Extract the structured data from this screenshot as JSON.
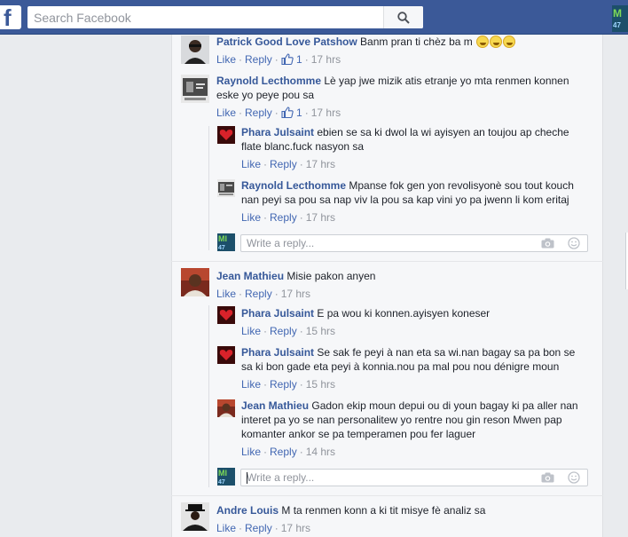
{
  "search": {
    "placeholder": "Search Facebook"
  },
  "colors": {
    "topbar": "#3b5998",
    "link": "#365899",
    "action_link": "#4267b2",
    "meta": "#90949c"
  },
  "comments": [
    {
      "name": "Patrick Good Love Patshow",
      "text": "Banm pran ti chèz ba m",
      "emoji_count": 3,
      "like": "Like",
      "reply": "Reply",
      "likes": "1",
      "time": "17 hrs"
    },
    {
      "name": "Raynold Lecthomme",
      "text_lines": [
        "Lè yap jwe mizik atis etranje yo mta renmen konnen",
        "eske yo peye pou sa"
      ],
      "like": "Like",
      "reply": "Reply",
      "likes": "1",
      "time": "17 hrs",
      "replies": [
        {
          "name": "Phara Julsaint",
          "text_lines": [
            "ebien se sa ki dwol la wi ayisyen an toujou ap cheche",
            "flate blanc.fuck nasyon sa"
          ],
          "like": "Like",
          "reply": "Reply",
          "time": "17 hrs"
        },
        {
          "name": "Raynold Lecthomme",
          "text_lines": [
            "Mpanse fok gen yon revolisyonè sou tout kouch",
            "nan peyi sa pou sa nap viv la pou sa kap vini yo pa jwenn li kom eritaj"
          ],
          "like": "Like",
          "reply": "Reply",
          "time": "17 hrs"
        }
      ],
      "reply_box": {
        "placeholder": "Write a reply..."
      }
    },
    {
      "name": "Jean Mathieu",
      "text": "Misie pakon anyen",
      "like": "Like",
      "reply": "Reply",
      "time": "17 hrs",
      "replies": [
        {
          "name": "Phara Julsaint",
          "text_lines": [
            "E pa wou ki konnen.ayisyen koneser"
          ],
          "like": "Like",
          "reply": "Reply",
          "time": "15 hrs"
        },
        {
          "name": "Phara Julsaint",
          "text_lines": [
            "Se sak fe peyi à nan eta sa wi.nan bagay sa pa bon se",
            "sa ki bon gade eta peyi à konnia.nou pa mal pou nou dénigre moun"
          ],
          "like": "Like",
          "reply": "Reply",
          "time": "15 hrs"
        },
        {
          "name": "Jean Mathieu",
          "text_lines": [
            "Gadon ekip moun depui ou di youn bagay ki pa aller nan",
            "interet pa yo se nan personalitew yo rentre nou gin reson Mwen pap",
            "komanter ankor se pa temperamen pou fer laguer"
          ],
          "like": "Like",
          "reply": "Reply",
          "time": "14 hrs"
        }
      ],
      "reply_box": {
        "placeholder": "Write a reply..."
      }
    },
    {
      "name": "Andre Louis",
      "text": "M ta renmen konn a ki tit misye fè analiz sa",
      "like": "Like",
      "reply": "Reply",
      "time": "17 hrs"
    }
  ],
  "icons": [
    "facebook-logo-icon",
    "search-icon",
    "like-thumb-icon",
    "camera-icon",
    "smiley-icon"
  ]
}
